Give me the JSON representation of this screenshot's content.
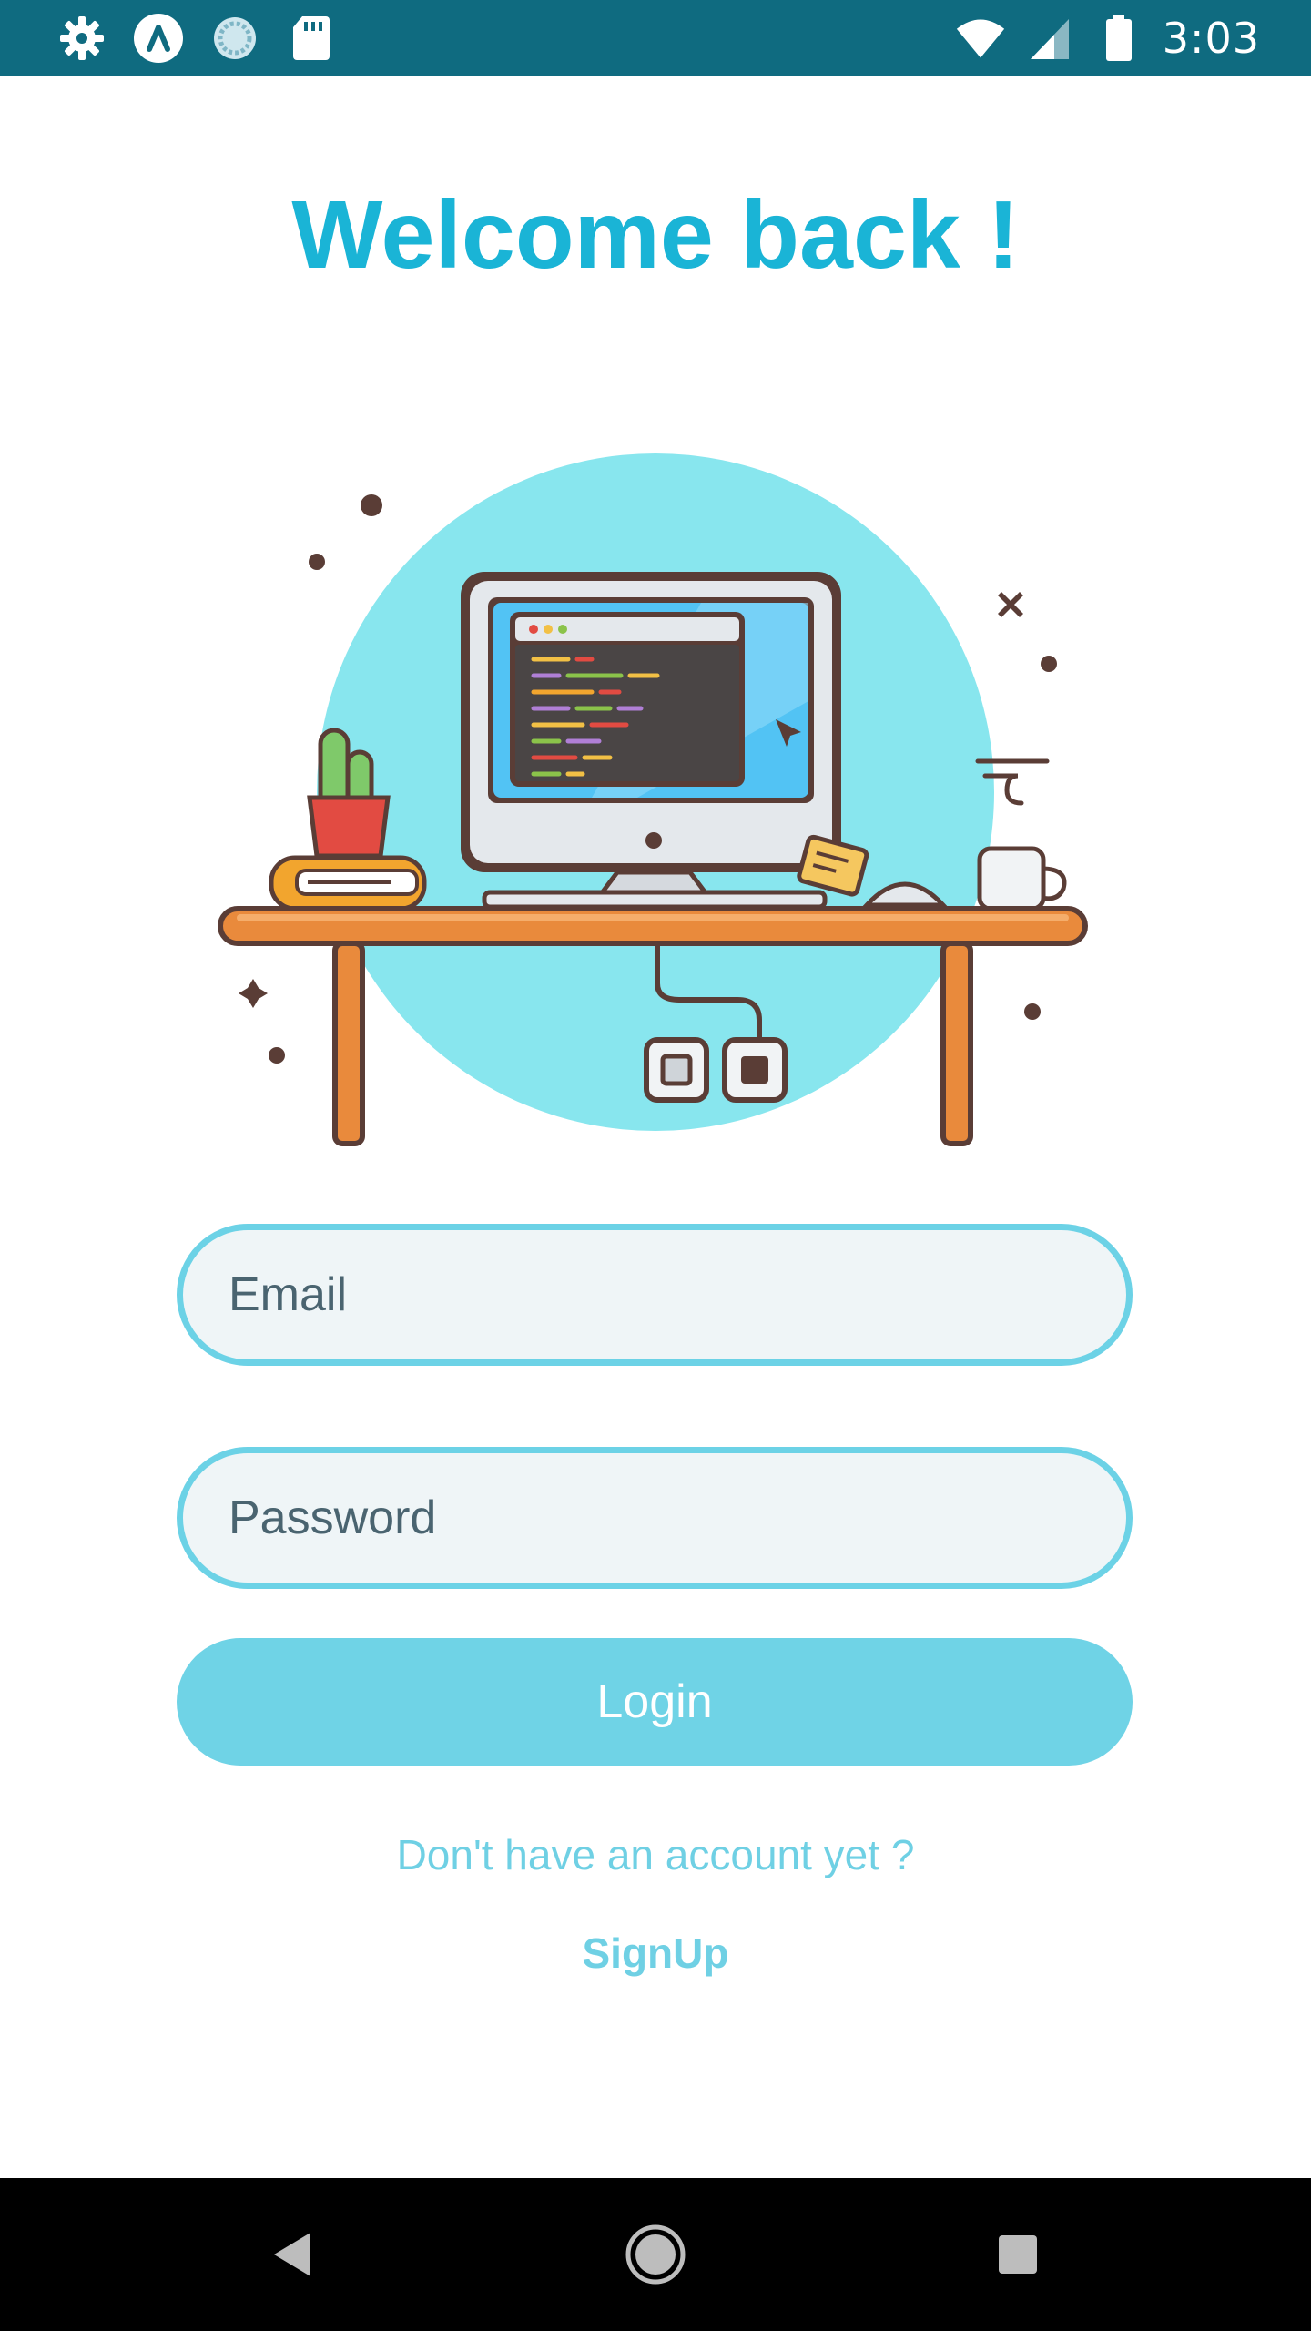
{
  "status_bar": {
    "time": "3:03",
    "left_icons": [
      "settings-icon",
      "launcher-icon",
      "sync-icon",
      "sd-card-icon"
    ],
    "right_icons": [
      "wifi-icon",
      "cellular-signal-icon",
      "battery-icon"
    ]
  },
  "header": {
    "title": "Welcome back !"
  },
  "illustration": {
    "name": "desk-computer-illustration"
  },
  "form": {
    "email_placeholder": "Email",
    "password_placeholder": "Password",
    "login_label": "Login"
  },
  "footer": {
    "signup_prompt": "Don't have an account yet ?",
    "signup_label": "SignUp"
  },
  "nav_bar": {
    "buttons": [
      "back-icon",
      "home-icon",
      "recents-icon"
    ]
  },
  "colors": {
    "status_bar": "#0f6b80",
    "accent": "#1ab4d6",
    "field_border": "#6cd2e6",
    "field_fill": "#eff5f7",
    "button": "#6fd3e6",
    "illustration_circle": "#88e6ee"
  }
}
